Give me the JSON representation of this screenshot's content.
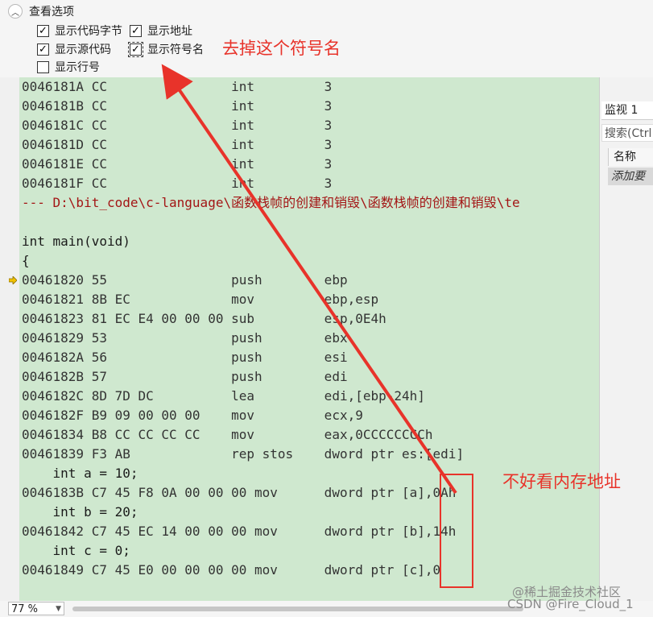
{
  "options": {
    "title": "查看选项",
    "checkboxes": {
      "show_code_bytes": {
        "label": "显示代码字节",
        "checked": true
      },
      "show_address": {
        "label": "显示地址",
        "checked": true
      },
      "show_source": {
        "label": "显示源代码",
        "checked": true
      },
      "show_symbol_names": {
        "label": "显示符号名",
        "checked": true
      },
      "show_line_numbers": {
        "label": "显示行号",
        "checked": false
      }
    },
    "check_mark": "✓"
  },
  "annotations": {
    "remove_symbol": "去掉这个符号名",
    "hard_to_read": "不好看内存地址",
    "color": "#e8332a"
  },
  "disassembly": [
    {
      "text": "0046181A CC                int         3",
      "kind": "asm"
    },
    {
      "text": "0046181B CC                int         3",
      "kind": "asm"
    },
    {
      "text": "0046181C CC                int         3",
      "kind": "asm"
    },
    {
      "text": "0046181D CC                int         3",
      "kind": "asm"
    },
    {
      "text": "0046181E CC                int         3",
      "kind": "asm"
    },
    {
      "text": "0046181F CC                int         3",
      "kind": "asm"
    },
    {
      "text": "--- D:\\bit_code\\c-language\\函数栈帧的创建和销毁\\函数栈帧的创建和销毁\\te",
      "kind": "sep"
    },
    {
      "text": "",
      "kind": "src"
    },
    {
      "text": "int main(void)",
      "kind": "src"
    },
    {
      "text": "{",
      "kind": "src"
    },
    {
      "text": "00461820 55                push        ebp",
      "kind": "asm",
      "current": true
    },
    {
      "text": "00461821 8B EC             mov         ebp,esp",
      "kind": "asm"
    },
    {
      "text": "00461823 81 EC E4 00 00 00 sub         esp,0E4h",
      "kind": "asm"
    },
    {
      "text": "00461829 53                push        ebx",
      "kind": "asm"
    },
    {
      "text": "0046182A 56                push        esi",
      "kind": "asm"
    },
    {
      "text": "0046182B 57                push        edi",
      "kind": "asm"
    },
    {
      "text": "0046182C 8D 7D DC          lea         edi,[ebp-24h]",
      "kind": "asm"
    },
    {
      "text": "0046182F B9 09 00 00 00    mov         ecx,9",
      "kind": "asm"
    },
    {
      "text": "00461834 B8 CC CC CC CC    mov         eax,0CCCCCCCCh",
      "kind": "asm"
    },
    {
      "text": "00461839 F3 AB             rep stos    dword ptr es:[edi]",
      "kind": "asm"
    },
    {
      "text": "    int a = 10;",
      "kind": "src"
    },
    {
      "text": "0046183B C7 45 F8 0A 00 00 00 mov      dword ptr [a],0Ah",
      "kind": "asm"
    },
    {
      "text": "    int b = 20;",
      "kind": "src"
    },
    {
      "text": "00461842 C7 45 EC 14 00 00 00 mov      dword ptr [b],14h",
      "kind": "asm"
    },
    {
      "text": "    int c = 0;",
      "kind": "src"
    },
    {
      "text": "00461849 C7 45 E0 00 00 00 00 mov      dword ptr [c],0",
      "kind": "asm"
    }
  ],
  "watch": {
    "tab_label": "监视 1",
    "search_placeholder": "搜索(Ctrl",
    "column_name": "名称",
    "add_item": "添加要"
  },
  "statusbar": {
    "zoom": "77 %"
  },
  "watermarks": {
    "line1": "@稀土掘金技术社区",
    "line2": "CSDN @Fire_Cloud_1"
  }
}
